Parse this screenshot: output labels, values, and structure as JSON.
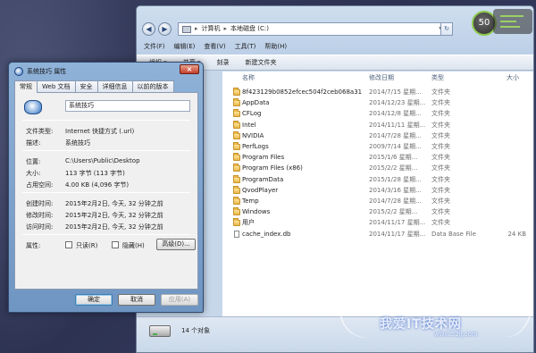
{
  "explorer": {
    "address": {
      "part1": "计算机",
      "part2": "本地磁盘 (C:)"
    },
    "menu": [
      "文件(F)",
      "编辑(E)",
      "查看(V)",
      "工具(T)",
      "帮助(H)"
    ],
    "toolbar": [
      "组织 ▾",
      "共享 ▾",
      "刻录",
      "新建文件夹"
    ],
    "columns": {
      "name": "名称",
      "date": "修改日期",
      "type": "类型",
      "size": "大小"
    },
    "rows": [
      {
        "name": "8f423129b0852efcec504f2ceb068a31",
        "date": "2014/7/15 星期...",
        "type": "文件夹",
        "size": "",
        "kind": "folder"
      },
      {
        "name": "AppData",
        "date": "2014/12/23 星期...",
        "type": "文件夹",
        "size": "",
        "kind": "folder"
      },
      {
        "name": "CFLog",
        "date": "2014/12/8 星期...",
        "type": "文件夹",
        "size": "",
        "kind": "folder"
      },
      {
        "name": "Intel",
        "date": "2014/11/11 星期...",
        "type": "文件夹",
        "size": "",
        "kind": "folder"
      },
      {
        "name": "NVIDIA",
        "date": "2014/7/28 星期...",
        "type": "文件夹",
        "size": "",
        "kind": "folder"
      },
      {
        "name": "PerfLogs",
        "date": "2009/7/14 星期...",
        "type": "文件夹",
        "size": "",
        "kind": "folder"
      },
      {
        "name": "Program Files",
        "date": "2015/1/6 星期...",
        "type": "文件夹",
        "size": "",
        "kind": "folder"
      },
      {
        "name": "Program Files (x86)",
        "date": "2015/2/2 星期...",
        "type": "文件夹",
        "size": "",
        "kind": "folder"
      },
      {
        "name": "ProgramData",
        "date": "2015/1/28 星期...",
        "type": "文件夹",
        "size": "",
        "kind": "folder"
      },
      {
        "name": "QvodPlayer",
        "date": "2014/3/16 星期...",
        "type": "文件夹",
        "size": "",
        "kind": "folder"
      },
      {
        "name": "Temp",
        "date": "2014/7/28 星期...",
        "type": "文件夹",
        "size": "",
        "kind": "folder"
      },
      {
        "name": "Windows",
        "date": "2015/2/2 星期...",
        "type": "文件夹",
        "size": "",
        "kind": "folder"
      },
      {
        "name": "用户",
        "date": "2014/11/17 星期...",
        "type": "文件夹",
        "size": "",
        "kind": "folder"
      },
      {
        "name": "cache_index.db",
        "date": "2014/11/17 星期...",
        "type": "Data Base File",
        "size": "24 KB",
        "kind": "file"
      }
    ],
    "status": "14 个对象"
  },
  "gauge": {
    "value": "50"
  },
  "watermark": {
    "text": "我爱IT技术网",
    "url": "www.52ij.com"
  },
  "dialog": {
    "title": "系统技巧 属性",
    "close": "×",
    "tabs": [
      "常规",
      "Web 文档",
      "安全",
      "详细信息",
      "以前的版本"
    ],
    "name": "系统技巧",
    "fields": [
      {
        "label": "文件类型:",
        "value": "Internet 快捷方式 (.url)"
      },
      {
        "label": "描述:",
        "value": "系统技巧"
      },
      {
        "label": "位置:",
        "value": "C:\\Users\\Public\\Desktop"
      },
      {
        "label": "大小:",
        "value": "113 字节 (113 字节)"
      },
      {
        "label": "占用空间:",
        "value": "4.00 KB (4,096 字节)"
      },
      {
        "label": "创建时间:",
        "value": "2015年2月2日, 今天, 32 分钟之前"
      },
      {
        "label": "修改时间:",
        "value": "2015年2月2日, 今天, 32 分钟之前"
      },
      {
        "label": "访问时间:",
        "value": "2015年2月2日, 今天, 32 分钟之前"
      }
    ],
    "attributes_label": "属性:",
    "readonly_label": "只读(R)",
    "hidden_label": "隐藏(H)",
    "advanced_label": "高级(D)...",
    "ok": "确定",
    "cancel": "取消",
    "apply": "应用(A)"
  }
}
